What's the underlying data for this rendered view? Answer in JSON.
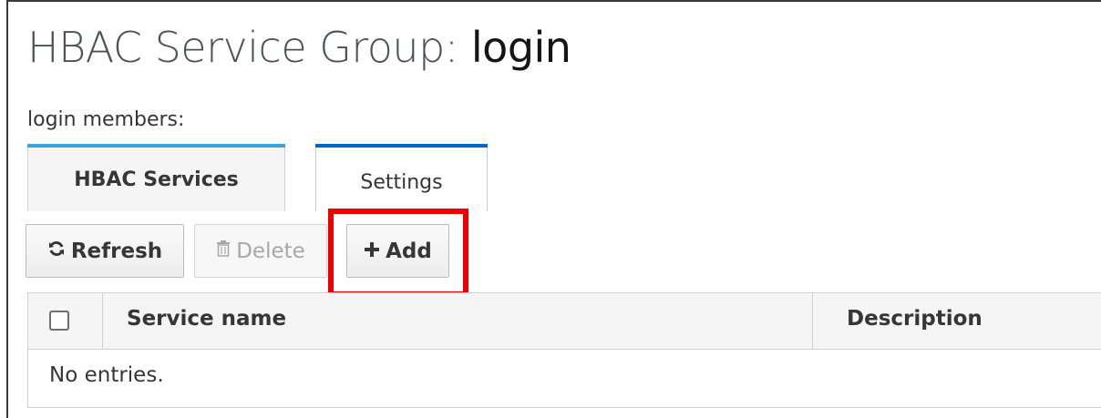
{
  "page": {
    "title_prefix": "HBAC Service Group: ",
    "title_name": "login",
    "members_label": "login members:"
  },
  "tabs": [
    {
      "label": "HBAC Services",
      "active": true
    },
    {
      "label": "Settings",
      "active": false
    }
  ],
  "toolbar": {
    "refresh_label": "Refresh",
    "refresh_icon": "refresh-icon",
    "delete_label": "Delete",
    "delete_icon": "trash-icon",
    "add_label": "Add",
    "add_icon": "plus-icon"
  },
  "table": {
    "columns": [
      "Service name",
      "Description"
    ],
    "empty_text": "No entries."
  },
  "colors": {
    "highlight": "#ee0000",
    "tab_accent": "#0066cc"
  }
}
